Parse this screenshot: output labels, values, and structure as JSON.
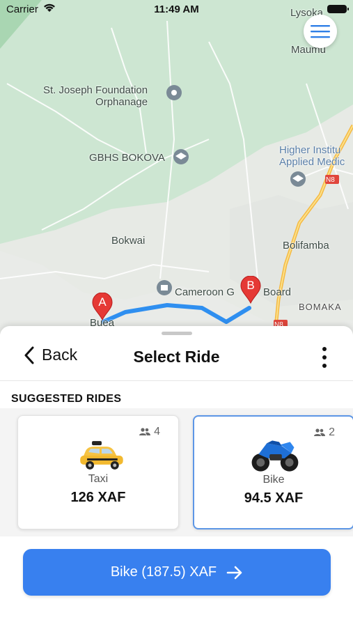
{
  "status_bar": {
    "carrier": "Carrier",
    "time": "11:49 AM"
  },
  "map": {
    "labels": {
      "lysoka": "Lysoka",
      "maumu": "Maumu",
      "st_joseph": "St. Joseph Foundation\nOrphanage",
      "gbhs": "GBHS BOKOVA",
      "higher_inst": "Higher Institu\nApplied Medic",
      "bokwai": "Bokwai",
      "bolifamba": "Bolifamba",
      "cameroon": "Cameroon G",
      "board": "Board",
      "bomaka": "BOMAKA",
      "buea": "Buea",
      "n8_top": "N8",
      "n8_bottom": "N8"
    },
    "markers": {
      "origin": "A",
      "destination": "B"
    },
    "colors": {
      "route": "#2f8ff0",
      "pin": "#e53935",
      "green": "#c9e4cf",
      "highway": "#f5b942"
    }
  },
  "sheet": {
    "back_label": "Back",
    "title": "Select Ride",
    "section_title": "SUGGESTED RIDES",
    "rides": [
      {
        "name": "Taxi",
        "price": "126 XAF",
        "seats": "4",
        "icon": "taxi-icon",
        "selected": false
      },
      {
        "name": "Bike",
        "price": "94.5 XAF",
        "seats": "2",
        "icon": "motorbike-icon",
        "selected": true
      }
    ],
    "confirm_label": "Bike (187.5) XAF",
    "accent": "#3880ef"
  }
}
